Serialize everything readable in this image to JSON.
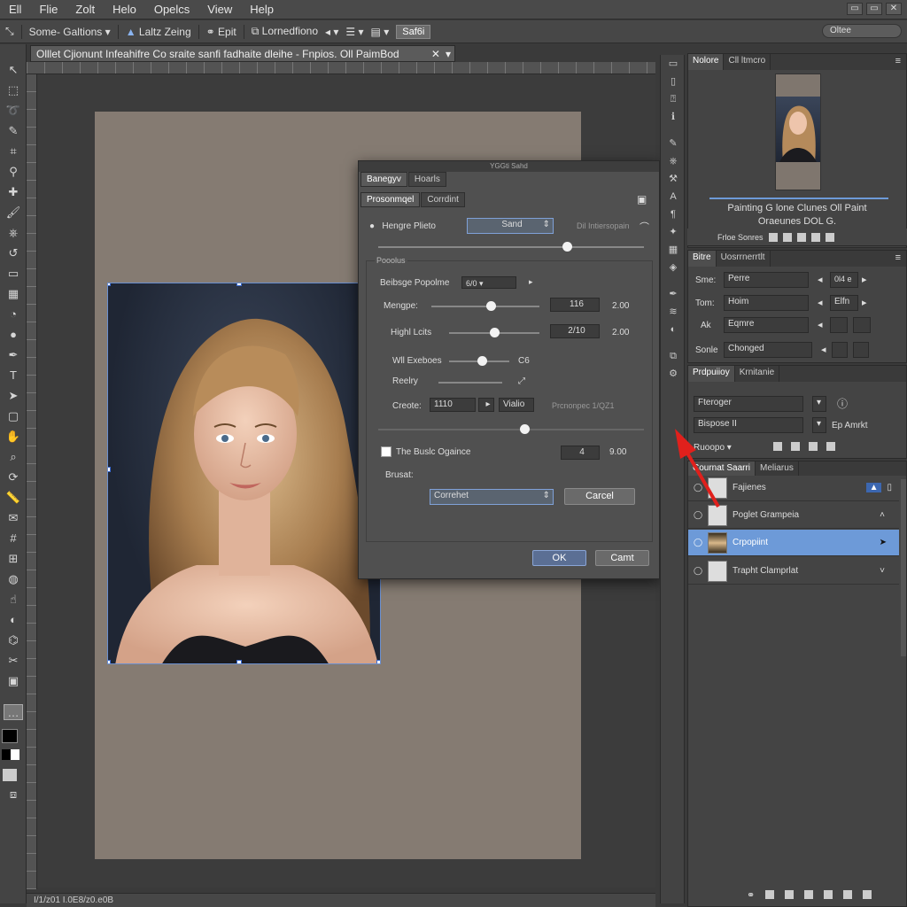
{
  "menu": [
    "Ell",
    "Flie",
    "Zolt",
    "Helo",
    "Opelcs",
    "View",
    "Help"
  ],
  "window_buttons": [
    "▭",
    "▭",
    "✕"
  ],
  "options_bar": {
    "preset": "Some- Galtions",
    "preset_arrow": "▾",
    "mode_label": "Laltz Zeing",
    "edit_label": "Epit",
    "layer_label": "Lornedfiono",
    "apply_button": "Saf6i",
    "search_placeholder": "Oltee"
  },
  "document_tab": {
    "title": "Olllet Cjionunt Infeahifre Co sraite sanfi fadhaite dleihe - Fnpios. Oll PaimBod",
    "close": "✕"
  },
  "status_bar": {
    "text": "I/1/z01   I.0E8/z0.e0B"
  },
  "dialog": {
    "title": "YGGti Sahd",
    "tabs": [
      "Banegyv",
      "Hoarls"
    ],
    "subtabs": [
      "Prosonmqel",
      "Corrdint"
    ],
    "row1_label": "Hengre Plieto",
    "row1_select": "Sand",
    "row1_hint": "Dil Intiersopain",
    "group_label": "Pooolus",
    "blend_label": "Beibsge Popolme",
    "blend_value": "6/0",
    "margin_label": "Mengpe:",
    "margin_value": "116",
    "margin_extra": "2.00",
    "height_label": "Highl Lcits",
    "height_value": "2/10",
    "height_extra": "2.00",
    "wall_label": "Wll Exeboes",
    "wall_value": "C6",
    "ready_label": "Reelry",
    "create_label": "Creote:",
    "create_value": "1110",
    "create_extra": "Vialio",
    "create_hint": "Prcnonpec 1/QZ1",
    "checkbox_label": "The Buslc Ogaince",
    "checkbox_value": "4",
    "checkbox_extra": "9.00",
    "brush_label": "Brusat:",
    "brush_select": "Correhet",
    "cancel_inner": "Carcel",
    "ok": "OK",
    "cancel": "Camt"
  },
  "navigator": {
    "tabs": [
      "Nolore",
      "Cll ltmcro"
    ],
    "caption_line1": "Painting G lone Clunes  Oll Paint",
    "caption_line2": "Oraeunes DOL G."
  },
  "nav_toolbar_label": "Frloe Sonres",
  "styles_panel": {
    "tabs": [
      "Bitre",
      "Uosrrnerrtlt"
    ],
    "rows": [
      {
        "label": "Sme:",
        "value": "Perre",
        "right": "0l4 e"
      },
      {
        "label": "Tom:",
        "value": "Hoim",
        "right": "Elfn"
      },
      {
        "label": "Ak",
        "value": "Eqmre",
        "right": ""
      },
      {
        "label": "Sonle",
        "value": "Chonged",
        "right": ""
      }
    ]
  },
  "properties_panel": {
    "tabs": [
      "Prdpuiioy",
      "Krnitanie"
    ],
    "field1": "Fteroger",
    "field2": "Bispose II",
    "field2_hint": "Ep Amrkt",
    "label": "Ruoopo"
  },
  "layers_panel": {
    "tabs": [
      "Cournat Saarri",
      "Meliarus"
    ],
    "layers": [
      {
        "name": "Fajienes",
        "selected": false
      },
      {
        "name": "Poglet Grampeia",
        "selected": false
      },
      {
        "name": "Crpopiint",
        "selected": true
      },
      {
        "name": "Trapht Clamprlat",
        "selected": false
      }
    ]
  },
  "colors": {
    "selection": "#6d9ad8",
    "accent_arrow": "#e0201c",
    "artboard": "#857b72"
  }
}
